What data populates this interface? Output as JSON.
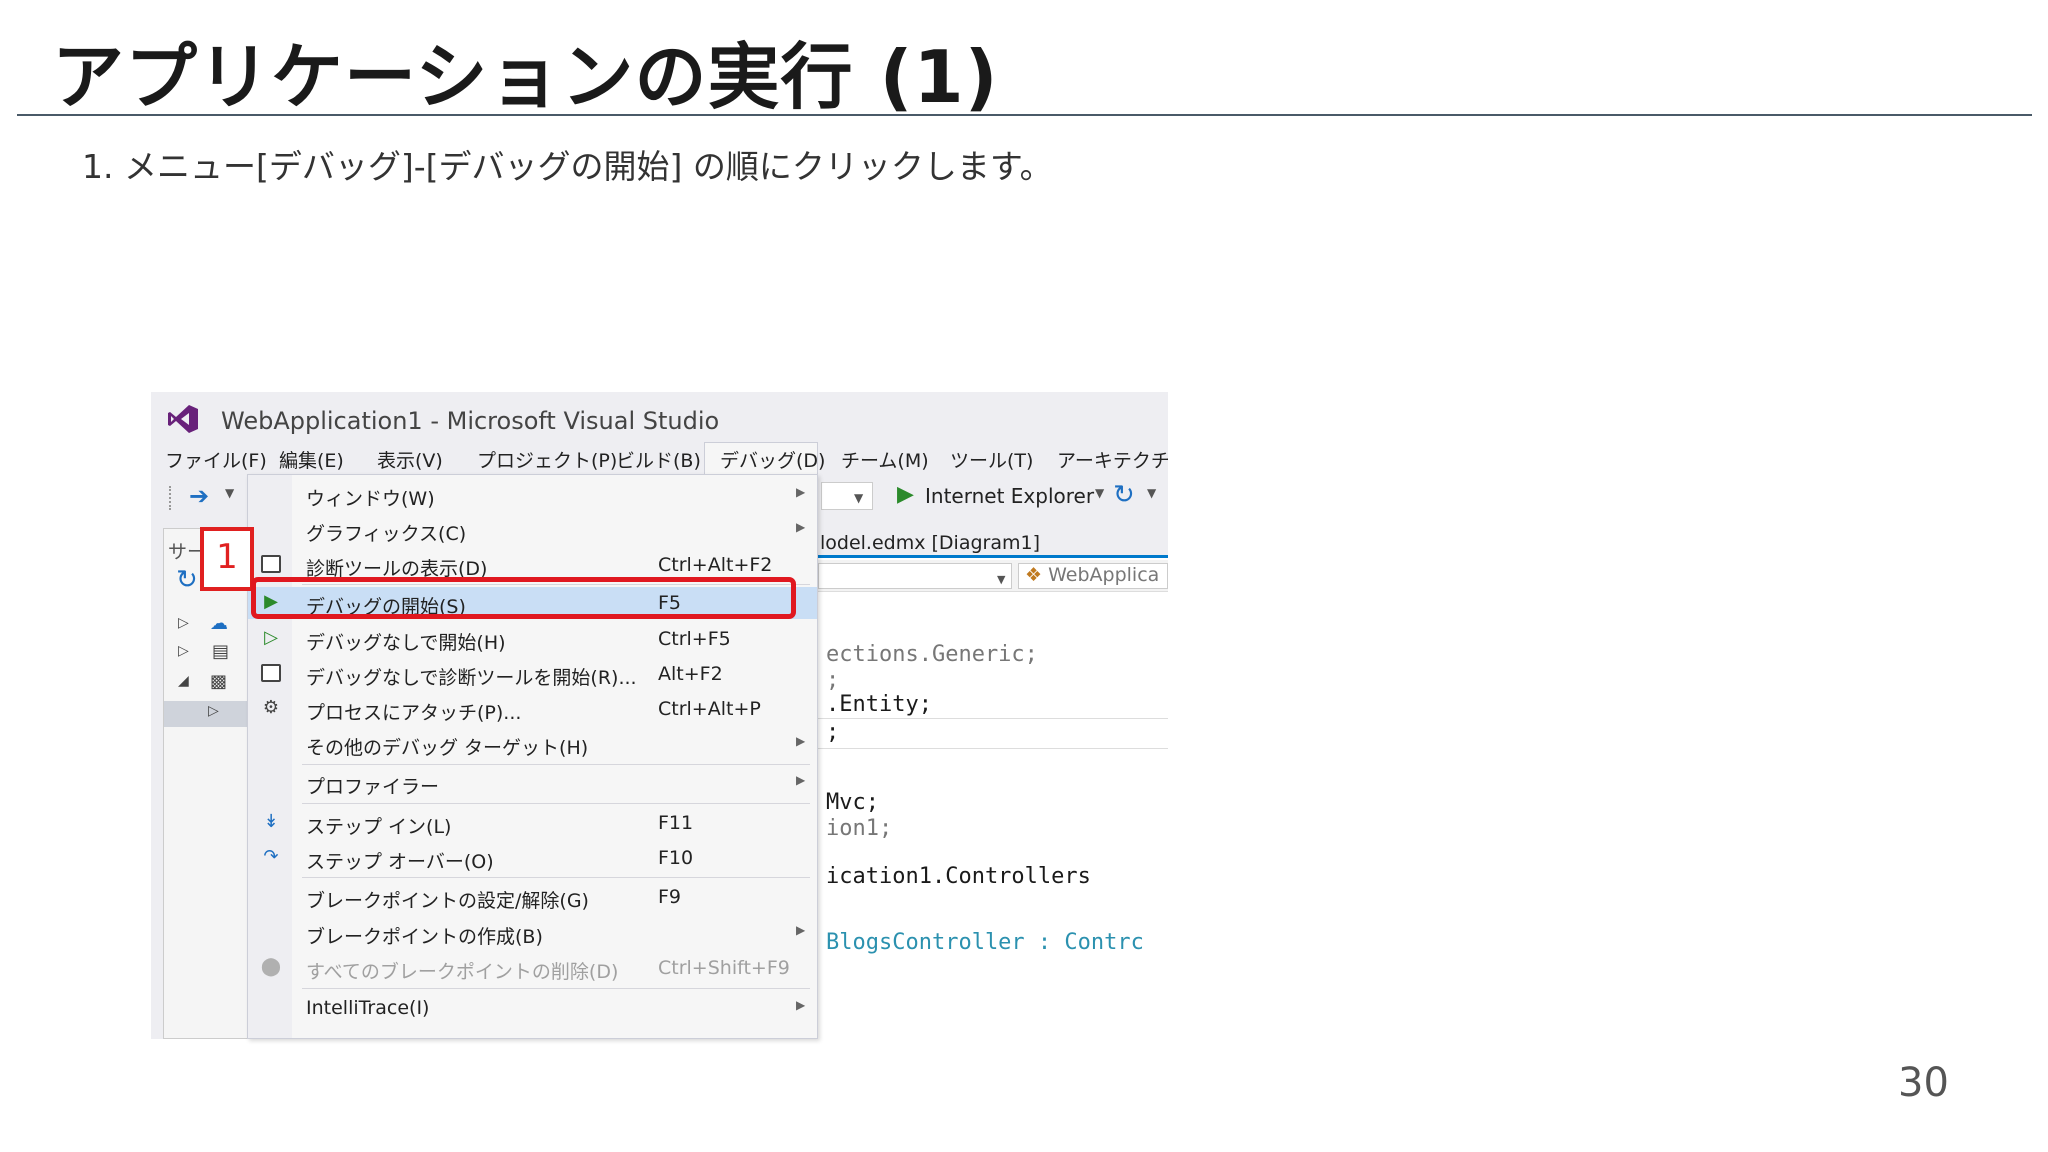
{
  "slide": {
    "title": "アプリケーションの実行 (1)",
    "step": "1.  メニュー[デバッグ]-[デバッグの開始] の順にクリックします。",
    "page_number": "30"
  },
  "vs": {
    "window_title": "WebApplication1 - Microsoft Visual Studio",
    "menubar": [
      "ファイル(F)",
      "編集(E)",
      "表示(V)",
      "プロジェクト(P)",
      "ビルド(B)",
      "デバッグ(D)",
      "チーム(M)",
      "ツール(T)",
      "アーキテクチャ("
    ],
    "toolbar": {
      "browser_label": "Internet Explorer"
    },
    "left_panel": {
      "label": "サー"
    },
    "editor": {
      "tab": "lodel.edmx [Diagram1]",
      "nav_right": "WebApplica",
      "code": [
        "ections.Generic;",
        ";",
        ".Entity;",
        ";",
        "Mvc;",
        "ion1;",
        "ication1.Controllers",
        "BlogsController : Contrc"
      ]
    },
    "debug_menu": [
      {
        "label": "ウィンドウ(W)",
        "shortcut": "",
        "submenu": true,
        "icon": ""
      },
      {
        "label": "グラフィックス(C)",
        "shortcut": "",
        "submenu": true,
        "icon": ""
      },
      {
        "label": "診断ツールの表示(D)",
        "shortcut": "Ctrl+Alt+F2",
        "submenu": false,
        "icon": "diagnostics-icon"
      },
      {
        "label": "デバッグの開始(S)",
        "shortcut": "F5",
        "submenu": false,
        "icon": "play-icon"
      },
      {
        "label": "デバッグなしで開始(H)",
        "shortcut": "Ctrl+F5",
        "submenu": false,
        "icon": "play-outline-icon"
      },
      {
        "label": "デバッグなしで診断ツールを開始(R)...",
        "shortcut": "Alt+F2",
        "submenu": false,
        "icon": "diagnostics-icon"
      },
      {
        "label": "プロセスにアタッチ(P)...",
        "shortcut": "Ctrl+Alt+P",
        "submenu": false,
        "icon": "gears-icon"
      },
      {
        "label": "その他のデバッグ ターゲット(H)",
        "shortcut": "",
        "submenu": true,
        "icon": ""
      },
      {
        "label": "プロファイラー",
        "shortcut": "",
        "submenu": true,
        "icon": ""
      },
      {
        "label": "ステップ イン(L)",
        "shortcut": "F11",
        "submenu": false,
        "icon": "step-into-icon"
      },
      {
        "label": "ステップ オーバー(O)",
        "shortcut": "F10",
        "submenu": false,
        "icon": "step-over-icon"
      },
      {
        "label": "ブレークポイントの設定/解除(G)",
        "shortcut": "F9",
        "submenu": false,
        "icon": ""
      },
      {
        "label": "ブレークポイントの作成(B)",
        "shortcut": "",
        "submenu": true,
        "icon": ""
      },
      {
        "label": "すべてのブレークポイントの削除(D)",
        "shortcut": "Ctrl+Shift+F9",
        "submenu": false,
        "icon": "delete-breakpoints-icon",
        "disabled": true
      },
      {
        "label": "IntelliTrace(I)",
        "shortcut": "",
        "submenu": true,
        "icon": ""
      }
    ]
  },
  "annotation": {
    "callout_number": "1",
    "color": "#e02020"
  },
  "colors": {
    "accent": "#007acc",
    "highlight": "#c9def5",
    "play": "#2b8a2b",
    "vs_purple": "#68217a"
  }
}
